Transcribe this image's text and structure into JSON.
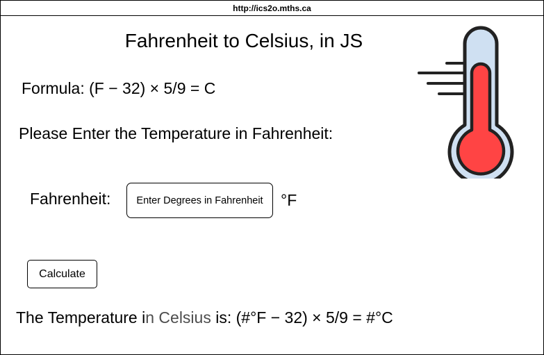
{
  "browser": {
    "url": "http://ics2o.mths.ca"
  },
  "page": {
    "title": "Fahrenheit to Celsius, in JS",
    "formula": "Formula: (F − 32) × 5/9 = C",
    "prompt": "Please Enter the Temperature in Fahrenheit:"
  },
  "form": {
    "fahrenheit_label": "Fahrenheit:",
    "input_placeholder": "Enter Degrees in Fahrenheit",
    "unit": "°F",
    "calculate_label": "Calculate"
  },
  "result": {
    "part1": "The Temperature i",
    "part2": "n Celsius",
    "part3": " is: (#°F − 32) × 5/9 = #°C"
  },
  "icons": {
    "thermometer": "thermometer-icon"
  },
  "colors": {
    "mercury": "#ff4444",
    "tube": "#cfe0f2",
    "outline": "#222222"
  }
}
